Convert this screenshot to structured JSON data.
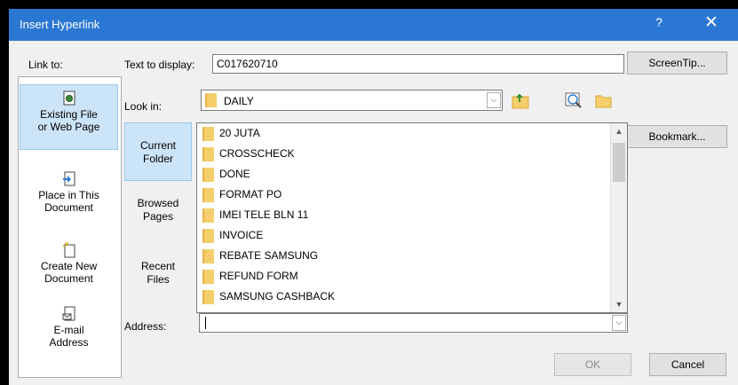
{
  "window": {
    "title": "Insert Hyperlink",
    "help": "?",
    "close": "✕"
  },
  "link_to": {
    "label": "Link to:",
    "items": [
      {
        "line1": "Existing File",
        "line2": "or Web Page",
        "icon": "existing-file-icon",
        "selected": true
      },
      {
        "line1": "Place in This",
        "line2": "Document",
        "icon": "place-in-document-icon",
        "selected": false
      },
      {
        "line1": "Create New",
        "line2": "Document",
        "icon": "create-new-document-icon",
        "selected": false
      },
      {
        "line1": "E-mail",
        "line2": "Address",
        "icon": "email-address-icon",
        "selected": false
      }
    ]
  },
  "text_to_display": {
    "label": "Text to display:",
    "value": "C017620710"
  },
  "screentip_label": "ScreenTip...",
  "look_in": {
    "label": "Look in:",
    "value": "DAILY"
  },
  "bookmark_label": "Bookmark...",
  "tabs": [
    {
      "line1": "Current",
      "line2": "Folder",
      "selected": true
    },
    {
      "line1": "Browsed",
      "line2": "Pages",
      "selected": false
    },
    {
      "line1": "Recent",
      "line2": "Files",
      "selected": false
    }
  ],
  "files": [
    "20 JUTA",
    "CROSSCHECK",
    "DONE",
    "FORMAT PO",
    "IMEI TELE BLN 11",
    "INVOICE",
    "REBATE SAMSUNG",
    "REFUND FORM",
    "SAMSUNG CASHBACK"
  ],
  "address": {
    "label": "Address:",
    "value": ""
  },
  "ok_label": "OK",
  "cancel_label": "Cancel",
  "colors": {
    "titlebar": "#2b78d4",
    "selection": "#cce4f7",
    "dialog_bg": "#f0f0f0"
  }
}
